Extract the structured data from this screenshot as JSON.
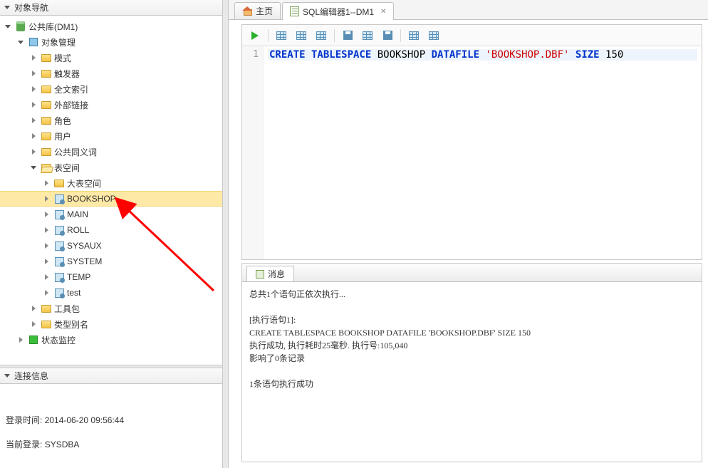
{
  "nav": {
    "title": "对象导航",
    "root": "公共库(DM1)",
    "objMgmt": "对象管理",
    "items": [
      "模式",
      "触发器",
      "全文索引",
      "外部链接",
      "角色",
      "用户",
      "公共同义词"
    ],
    "tablespace": "表空间",
    "tsChildren": [
      "大表空间",
      "BOOKSHOP",
      "MAIN",
      "ROLL",
      "SYSAUX",
      "SYSTEM",
      "TEMP",
      "test"
    ],
    "selectedTs": "BOOKSHOP",
    "toolkit": "工具包",
    "typeAlias": "类型别名",
    "statusMon": "状态监控"
  },
  "conn": {
    "title": "连接信息",
    "loginTimeLabel": "登录时间:",
    "loginTime": "2014-06-20 09:56:44",
    "currentLoginLabel": "当前登录:",
    "currentLogin": "SYSDBA"
  },
  "tabs": {
    "home": "主页",
    "sqlEditor": "SQL编辑器1--DM1"
  },
  "sql": {
    "line": "1",
    "kw1": "CREATE TABLESPACE",
    "ident": " BOOKSHOP ",
    "kw2": "DATAFILE",
    "str": " 'BOOKSHOP.DBF' ",
    "kw3": "SIZE",
    "num": " 150"
  },
  "msg": {
    "tab": "消息",
    "body": "总共1个语句正依次执行...\n\n[执行语句1]:\nCREATE TABLESPACE BOOKSHOP DATAFILE 'BOOKSHOP.DBF' SIZE 150\n执行成功, 执行耗时25毫秒. 执行号:105,040\n影响了0条记录\n\n1条语句执行成功"
  }
}
